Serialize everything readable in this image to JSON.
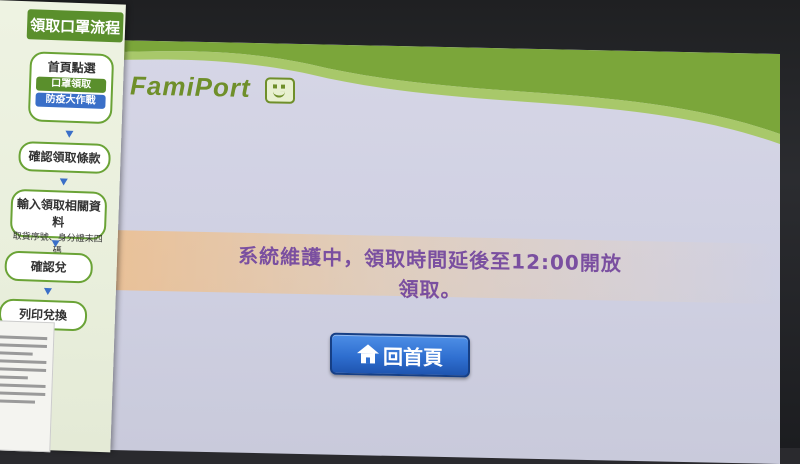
{
  "kiosk": {
    "brand": "FamiPort",
    "message_line1": "系統維護中，領取時間延後至12:00開放",
    "message_line2": "領取。",
    "home_button_label": "回首頁",
    "home_icon": "home-icon"
  },
  "sign": {
    "title": "領取口罩流程",
    "steps": [
      {
        "label": "首頁點選",
        "sub_a": "口罩領取",
        "sub_b": "防疫大作戰"
      },
      {
        "label": "確認領取條款"
      },
      {
        "label": "輸入領取相關資料",
        "sub": "取貨序號、身分證末四碼"
      },
      {
        "label": "確認兌"
      },
      {
        "label": "列印兌換"
      }
    ]
  },
  "colors": {
    "brand_green": "#6f8f2a",
    "message_purple": "#7a4fa0",
    "button_blue": "#2f6fd0"
  }
}
